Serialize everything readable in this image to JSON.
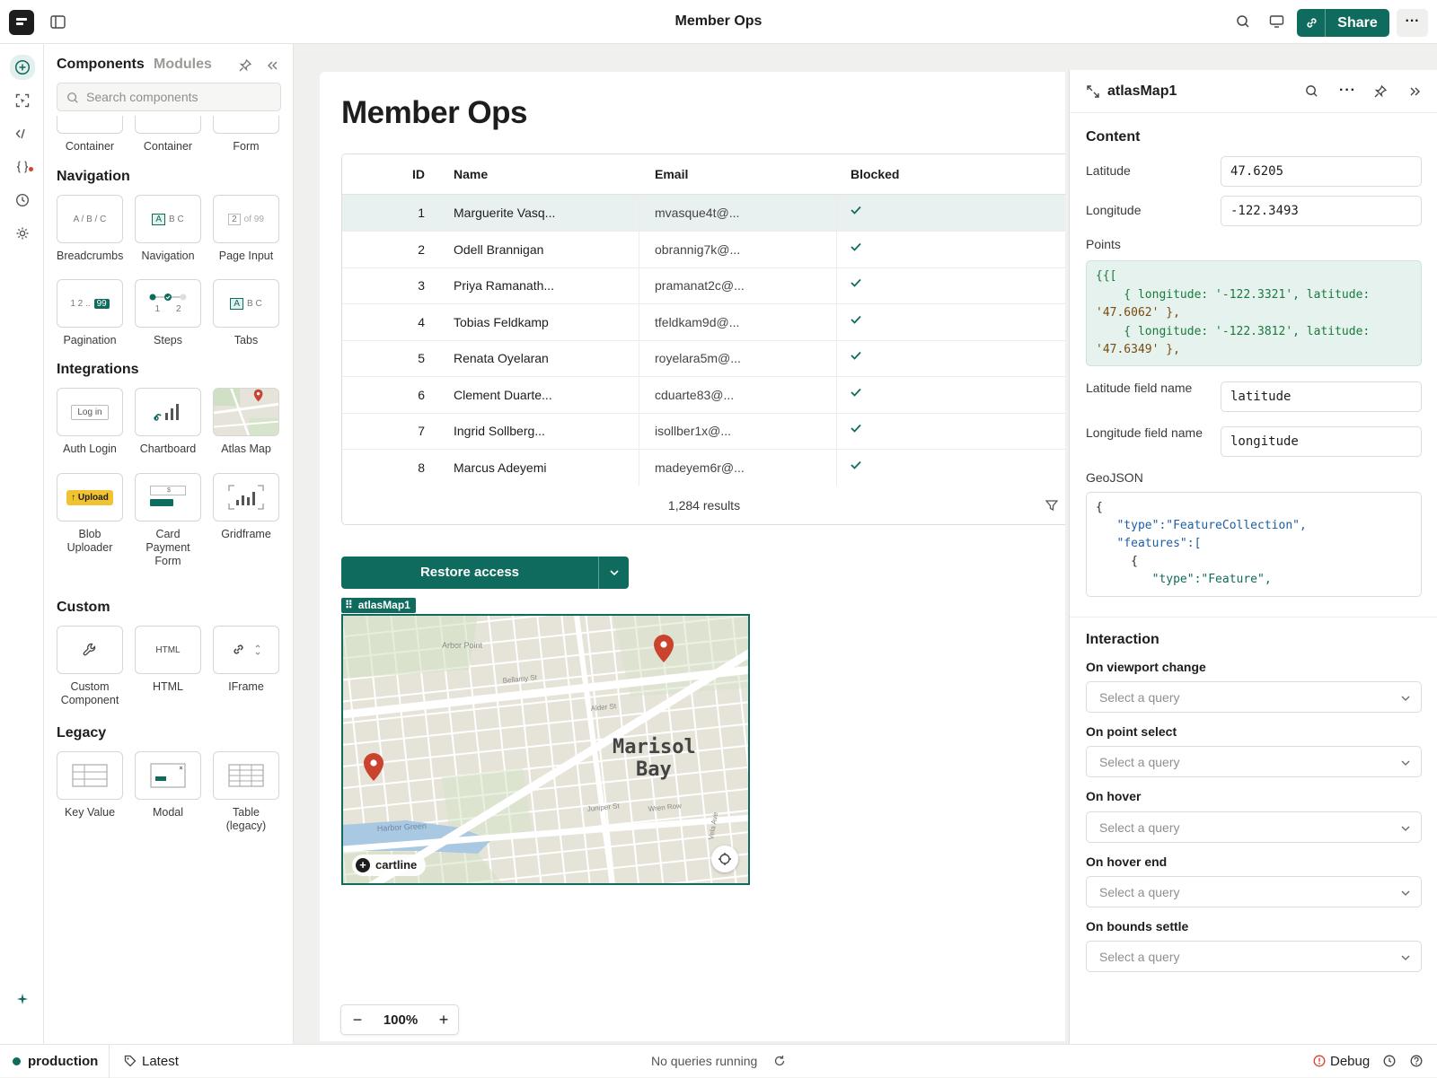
{
  "topbar": {
    "title": "Member Ops",
    "share_label": "Share",
    "more_label": "···"
  },
  "components_panel": {
    "tabs": [
      "Components",
      "Modules"
    ],
    "search_placeholder": "Search components",
    "top_partial_tiles": [
      "Container",
      "Container",
      "Form"
    ],
    "sections": [
      {
        "title": "Navigation",
        "tiles": [
          "Breadcrumbs",
          "Navigation",
          "Page Input",
          "Pagination",
          "Steps",
          "Tabs"
        ]
      },
      {
        "title": "Integrations",
        "tiles": [
          "Auth Login",
          "Chartboard",
          "Atlas Map",
          "Blob Uploader",
          "Card Payment Form",
          "Gridframe"
        ]
      },
      {
        "title": "Custom",
        "tiles": [
          "Custom Component",
          "HTML",
          "IFrame"
        ]
      },
      {
        "title": "Legacy",
        "tiles": [
          "Key Value",
          "Modal",
          "Table (legacy)"
        ]
      }
    ],
    "tile_glyphs": {
      "breadcrumbs": "A / B / C",
      "navigation": "B C",
      "navigation_active": "A",
      "page_input_num": "2",
      "page_input_suffix": "of 99",
      "pagination": "1 2 ..",
      "pagination_active": "99",
      "steps_1": "1",
      "steps_2": "2",
      "tabs_active": "A",
      "tabs": "B C",
      "auth_login": "Log in",
      "upload": "↑ Upload",
      "card_dollar": "$",
      "html": "HTML"
    }
  },
  "canvas": {
    "page_title": "Member Ops",
    "table": {
      "columns": [
        "ID",
        "Name",
        "Email",
        "Blocked"
      ],
      "rows": [
        {
          "id": "1",
          "name": "Marguerite Vasq...",
          "email": "mvasque4t@...",
          "blocked": true
        },
        {
          "id": "2",
          "name": "Odell Brannigan",
          "email": "obrannig7k@...",
          "blocked": true
        },
        {
          "id": "3",
          "name": "Priya Ramanath...",
          "email": "pramanat2c@...",
          "blocked": true
        },
        {
          "id": "4",
          "name": "Tobias Feldkamp",
          "email": "tfeldkam9d@...",
          "blocked": true
        },
        {
          "id": "5",
          "name": "Renata Oyelaran",
          "email": "royelara5m@...",
          "blocked": true
        },
        {
          "id": "6",
          "name": "Clement Duarte...",
          "email": "cduarte83@...",
          "blocked": true
        },
        {
          "id": "7",
          "name": "Ingrid Sollberg...",
          "email": "isollber1x@...",
          "blocked": true
        },
        {
          "id": "8",
          "name": "Marcus Adeyemi",
          "email": "madeyem6r@...",
          "blocked": true
        }
      ],
      "selected_row": 1,
      "results_label": "1,284 results"
    },
    "restore_button": "Restore access",
    "map": {
      "tag": "atlasMap1",
      "city_label_1": "Marisol",
      "city_label_2": "Bay",
      "street_labels": [
        "Arbor Point",
        "Bellamy St",
        "Alder St",
        "Juniper St",
        "Wren Row",
        "Vela Ave",
        "Harbor Green"
      ],
      "badge": "cartline"
    },
    "zoom": {
      "level": "100%",
      "minus": "−",
      "plus": "+"
    }
  },
  "inspector": {
    "component_name": "atlasMap1",
    "more_label": "···",
    "content_title": "Content",
    "latitude_label": "Latitude",
    "latitude_value": "47.6205",
    "longitude_label": "Longitude",
    "longitude_value": "-122.3493",
    "points_label": "Points",
    "points_lines": [
      "{{[",
      "    { longitude: '-122.3321', latitude:",
      "'47.6062' },",
      "    { longitude: '-122.3812', latitude:",
      "'47.6349' },"
    ],
    "lat_field_label": "Latitude field name",
    "lat_field_value": "latitude",
    "lng_field_label": "Longitude field name",
    "lng_field_value": "longitude",
    "geojson_label": "GeoJSON",
    "geojson_lines": [
      "{",
      "   \"type\":\"FeatureCollection\",",
      "   \"features\":[",
      "     {",
      "        \"type\":\"Feature\","
    ],
    "interaction_title": "Interaction",
    "events": [
      {
        "label": "On viewport change",
        "value": "Select a query"
      },
      {
        "label": "On point select",
        "value": "Select a query"
      },
      {
        "label": "On hover",
        "value": "Select a query"
      },
      {
        "label": "On hover end",
        "value": "Select a query"
      },
      {
        "label": "On bounds settle",
        "value": "Select a query"
      }
    ]
  },
  "statusbar": {
    "environment": "production",
    "version": "Latest",
    "queries": "No queries running",
    "debug": "Debug"
  },
  "colors": {
    "accent": "#0f6b5d",
    "selected_row": "#e8f1ef",
    "map_pin": "#c9432f",
    "debug": "#d9432e"
  },
  "icons": [
    "logo-icon",
    "panel-toggle-icon",
    "search-icon",
    "preview-icon",
    "link-icon",
    "plus-circle-icon",
    "select-icon",
    "code-icon",
    "braces-icon",
    "history-icon",
    "settings-icon",
    "sparkle-icon",
    "pin-icon",
    "collapse-icon",
    "check-icon",
    "filter-icon",
    "chevron-down-icon",
    "expand-icon",
    "close-icon",
    "tag-icon",
    "refresh-icon",
    "alert-icon",
    "clock-icon",
    "help-icon",
    "map-pin-icon",
    "locate-icon"
  ]
}
